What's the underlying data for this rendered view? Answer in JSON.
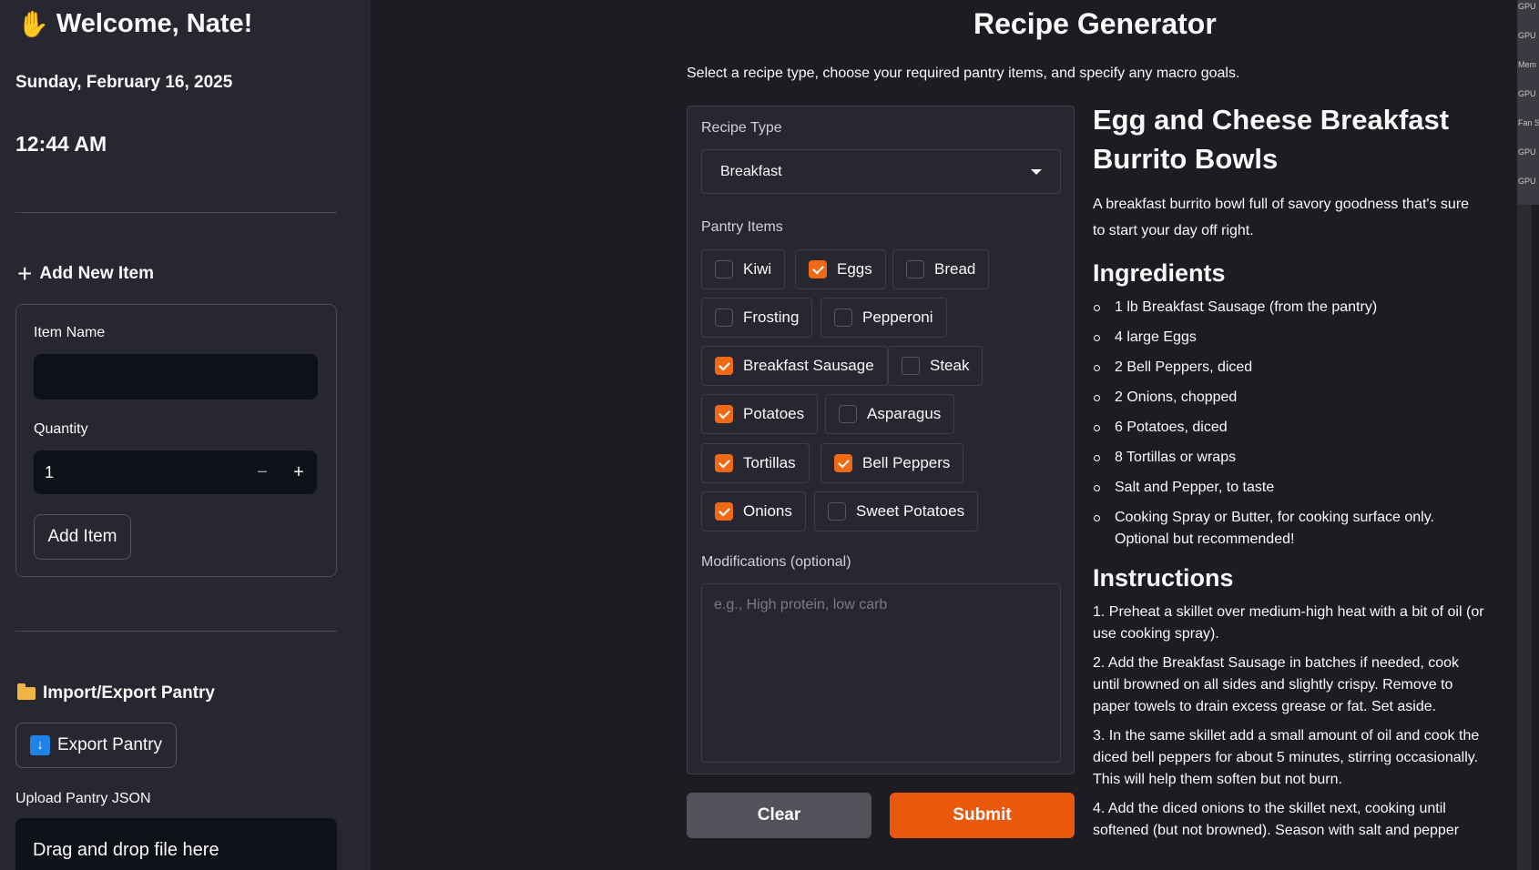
{
  "sidebar": {
    "welcome": "Welcome, Nate!",
    "welcome_icon": "waving-hand-icon",
    "date": "Sunday, February 16, 2025",
    "time": "12:44 AM",
    "add_new_item": "Add New Item",
    "item_name_label": "Item Name",
    "item_name_value": "",
    "quantity_label": "Quantity",
    "quantity_value": "1",
    "minus": "−",
    "plus": "+",
    "add_item_button": "Add Item",
    "import_export": "Import/Export Pantry",
    "export_button": "Export Pantry",
    "upload_label": "Upload Pantry JSON",
    "dropzone_text": "Drag and drop file here"
  },
  "main": {
    "title": "Recipe Generator",
    "subtitle": "Select a recipe type, choose your required pantry items, and specify any macro goals.",
    "recipe_type_label": "Recipe Type",
    "recipe_type_value": "Breakfast",
    "pantry_label": "Pantry Items",
    "pantry_items": [
      {
        "label": "Kiwi",
        "checked": false
      },
      {
        "label": "Eggs",
        "checked": true
      },
      {
        "label": "Bread",
        "checked": false
      },
      {
        "label": "Frosting",
        "checked": false
      },
      {
        "label": "Pepperoni",
        "checked": false
      },
      {
        "label": "Breakfast Sausage",
        "checked": true
      },
      {
        "label": "Steak",
        "checked": false
      },
      {
        "label": "Potatoes",
        "checked": true
      },
      {
        "label": "Asparagus",
        "checked": false
      },
      {
        "label": "Tortillas",
        "checked": true
      },
      {
        "label": "Bell Peppers",
        "checked": true
      },
      {
        "label": "Onions",
        "checked": true
      },
      {
        "label": "Sweet Potatoes",
        "checked": false
      }
    ],
    "modifications_label": "Modifications (optional)",
    "modifications_placeholder": "e.g., High protein, low carb",
    "clear_button": "Clear",
    "submit_button": "Submit"
  },
  "recipe": {
    "title": "Egg and Cheese Breakfast Burrito Bowls",
    "description": "A breakfast burrito bowl full of savory goodness that's sure to start your day off right.",
    "ingredients_heading": "Ingredients",
    "ingredients": [
      "1 lb Breakfast Sausage (from the pantry)",
      "4 large Eggs",
      "2 Bell Peppers, diced",
      "2 Onions, chopped",
      "6 Potatoes, diced",
      "8 Tortillas or wraps",
      "Salt and Pepper, to taste",
      "Cooking Spray or Butter, for cooking surface only. Optional but recommended!"
    ],
    "instructions_heading": "Instructions",
    "instructions": [
      "1. Preheat a skillet over medium-high heat with a bit of oil (or use cooking spray).",
      "2. Add the Breakfast Sausage in batches if needed, cook until browned on all sides and slightly crispy. Remove to paper towels to drain excess grease or fat. Set aside.",
      "3. In the same skillet add a small amount of oil and cook the diced bell peppers for about 5 minutes, stirring occasionally. This will help them soften but not burn.",
      "4. Add the diced onions to the skillet next, cooking until softened (but not browned). Season with salt and pepper"
    ]
  },
  "overlay": {
    "labels": [
      "GPU",
      "GPU",
      "Mem",
      "GPU",
      "Fan S",
      "GPU",
      "GPU"
    ]
  },
  "colors": {
    "accent": "#ea580c",
    "checkbox": "#f06a16",
    "sidebar_bg": "#262730",
    "main_bg": "#1c1c22"
  }
}
